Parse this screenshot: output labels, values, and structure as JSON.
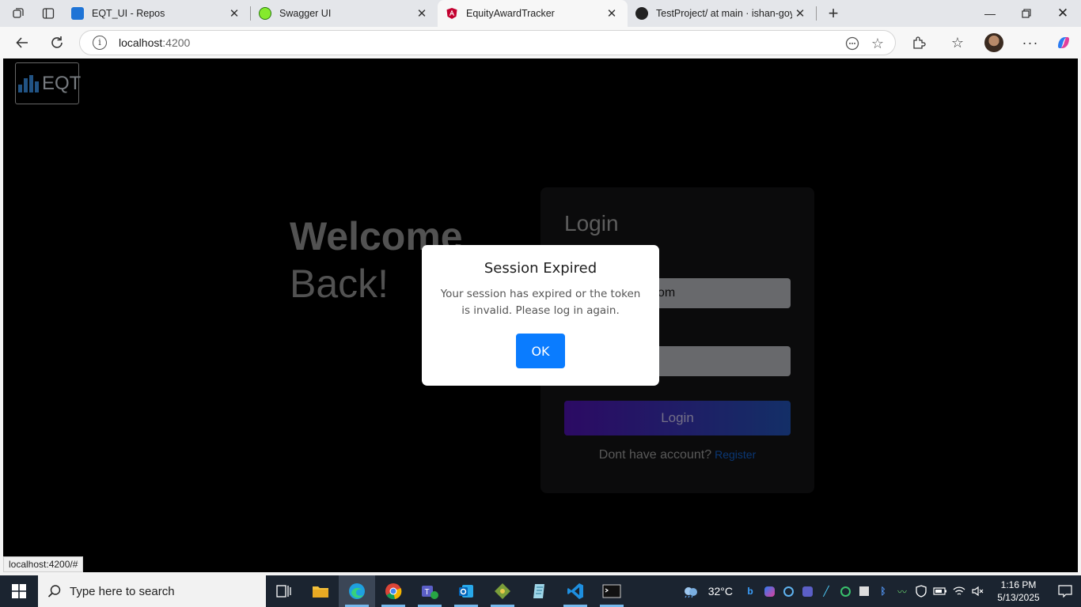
{
  "browser": {
    "tabs": [
      {
        "title": "EQT_UI - Repos",
        "favicon": "azure-devops-icon"
      },
      {
        "title": "Swagger UI",
        "favicon": "swagger-icon"
      },
      {
        "title": "EquityAwardTracker",
        "favicon": "angular-icon"
      },
      {
        "title": "TestProject/ at main · ishan-goyal",
        "favicon": "github-icon"
      }
    ],
    "active_tab": 2,
    "address": {
      "host": "localhost",
      "port": ":4200"
    }
  },
  "page": {
    "brand": "EQT",
    "welcome_line1": "Welcome",
    "welcome_line2": "Back!",
    "login": {
      "heading": "Login",
      "email_value": "com",
      "button_label": "Login",
      "register_prompt": "Dont have account?",
      "register_link": "Register"
    }
  },
  "dialog": {
    "title": "Session Expired",
    "message": "Your session has expired or the token is invalid. Please log in again.",
    "ok_label": "OK"
  },
  "status_url": "localhost:4200/#",
  "taskbar": {
    "search_placeholder": "Type here to search",
    "weather": "32°C",
    "time": "1:16 PM",
    "date": "5/13/2025"
  },
  "colors": {
    "dialog_button": "#0a7cff",
    "login_gradient_start": "#3b0e86",
    "login_gradient_end": "#1a3f8a",
    "register_link": "#0f4a9b"
  }
}
